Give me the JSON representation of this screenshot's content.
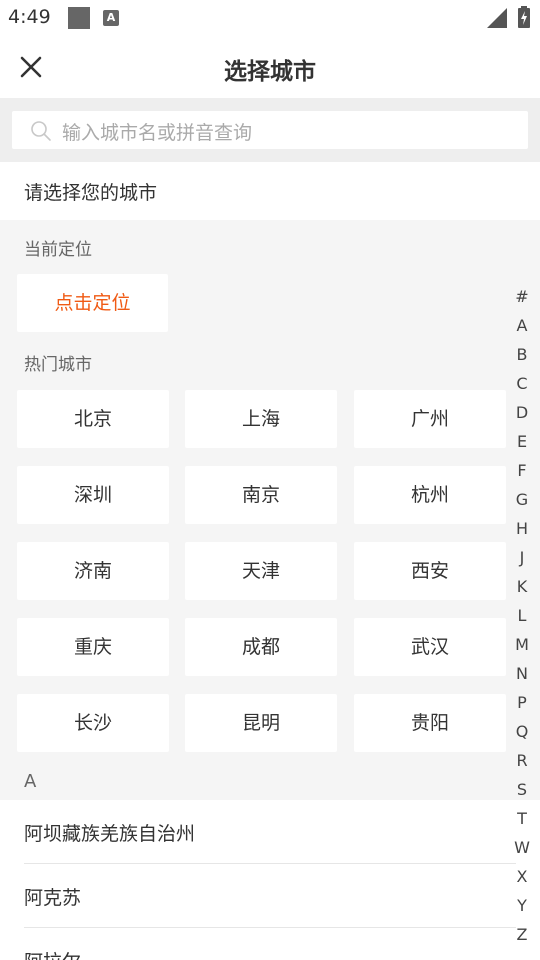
{
  "status_bar": {
    "time": "4:49",
    "a_icon_glyph": "A"
  },
  "header": {
    "title": "选择城市",
    "close_icon": "close-icon"
  },
  "search": {
    "placeholder": "输入城市名或拼音查询"
  },
  "prompt": "请选择您的城市",
  "current_location": {
    "label": "当前定位",
    "button": "点击定位"
  },
  "hot_cities": {
    "label": "热门城市",
    "items": [
      "北京",
      "上海",
      "广州",
      "深圳",
      "南京",
      "杭州",
      "济南",
      "天津",
      "西安",
      "重庆",
      "成都",
      "武汉",
      "长沙",
      "昆明",
      "贵阳"
    ]
  },
  "city_list": {
    "letter": "A",
    "items": [
      "阿坝藏族羌族自治州",
      "阿克苏",
      "阿拉尔"
    ]
  },
  "index_letters": [
    "#",
    "A",
    "B",
    "C",
    "D",
    "E",
    "F",
    "G",
    "H",
    "J",
    "K",
    "L",
    "M",
    "N",
    "P",
    "Q",
    "R",
    "S",
    "T",
    "W",
    "X",
    "Y",
    "Z"
  ],
  "colors": {
    "accent": "#f05a14",
    "background": "#f5f5f5"
  }
}
